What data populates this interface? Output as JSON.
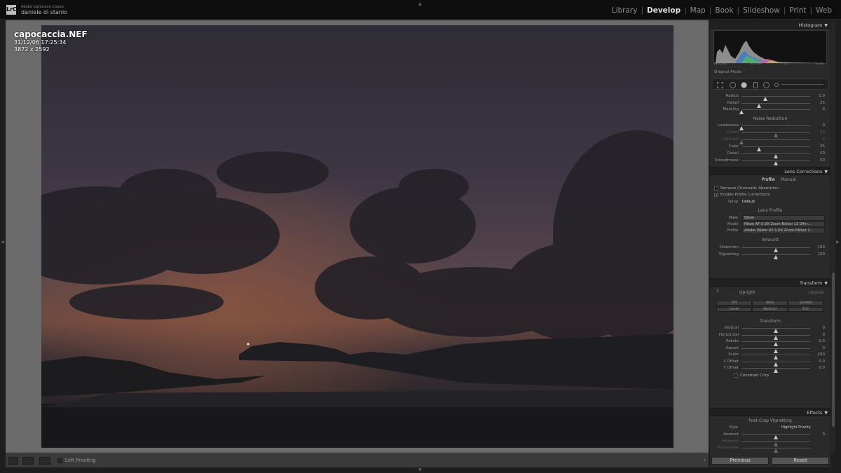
{
  "app": {
    "name": "Adobe Lightroom Classic",
    "user": "daniele di stanio",
    "logo": "LrC"
  },
  "modules": [
    "Library",
    "Develop",
    "Map",
    "Book",
    "Slideshow",
    "Print",
    "Web"
  ],
  "active_module": "Develop",
  "photo": {
    "filename": "capocaccia.NEF",
    "datetime": "31/12/06 17:25:34",
    "dimensions": "3872 x 2592"
  },
  "toolbar": {
    "soft_proofing": "Soft Proofing"
  },
  "histogram": {
    "title": "Histogram",
    "iso": "ISO 100",
    "focal": "24 mm",
    "aperture": "f / 11",
    "shutter": "½ sec",
    "original_photo": "Original Photo"
  },
  "detail": {
    "sharpen": [
      {
        "label": "Radius",
        "value": "1.0",
        "pos": 0.35
      },
      {
        "label": "Detail",
        "value": "25",
        "pos": 0.25
      },
      {
        "label": "Masking",
        "value": "0",
        "pos": 0.0
      }
    ],
    "noise_title": "Noise Reduction",
    "noise": [
      {
        "label": "Luminance",
        "value": "0",
        "pos": 0.0,
        "dim": false
      },
      {
        "label": "Detail",
        "value": "50",
        "pos": 0.5,
        "dim": true
      },
      {
        "label": "Contrast",
        "value": "0",
        "pos": 0.0,
        "dim": true
      },
      {
        "label": "Color",
        "value": "25",
        "pos": 0.25,
        "dim": false
      },
      {
        "label": "Detail",
        "value": "50",
        "pos": 0.5,
        "dim": false
      },
      {
        "label": "Smoothness",
        "value": "50",
        "pos": 0.5,
        "dim": false
      }
    ]
  },
  "lens": {
    "title": "Lens Corrections",
    "tab_profile": "Profile",
    "tab_manual": "Manual",
    "remove_ca": "Remove Chromatic Aberration",
    "enable_profile": "Enable Profile Corrections",
    "setup_label": "Setup",
    "setup_value": "Default",
    "lens_profile": "Lens Profile",
    "make_label": "Make",
    "make_value": "Nikon",
    "model_label": "Model",
    "model_value": "Nikon AF-S DX Zoom-Nikkor 12-24m...",
    "profile_label": "Profile",
    "profile_value": "Adobe (Nikon AF-S DX Zoom-Nikkor 1...",
    "amount": "Amount",
    "amounts": [
      {
        "label": "Distortion",
        "value": "100",
        "pos": 0.5,
        "dim": false
      },
      {
        "label": "Vignetting",
        "value": "100",
        "pos": 0.5,
        "dim": false
      }
    ]
  },
  "transform": {
    "title": "Transform",
    "upright": "Upright",
    "update": "Update",
    "buttons": [
      "Off",
      "Auto",
      "Guided",
      "Level",
      "Vertical",
      "Full"
    ],
    "sub": "Transform",
    "sliders": [
      {
        "label": "Vertical",
        "value": "0",
        "pos": 0.5
      },
      {
        "label": "Horizontal",
        "value": "0",
        "pos": 0.5
      },
      {
        "label": "Rotate",
        "value": "0.0",
        "pos": 0.5
      },
      {
        "label": "Aspect",
        "value": "0",
        "pos": 0.5
      },
      {
        "label": "Scale",
        "value": "100",
        "pos": 0.5
      },
      {
        "label": "X Offset",
        "value": "0.0",
        "pos": 0.5
      },
      {
        "label": "Y Offset",
        "value": "0.0",
        "pos": 0.5
      }
    ],
    "constrain": "Constrain Crop"
  },
  "effects": {
    "title": "Effects",
    "sub": "Post-Crop Vignetting",
    "style_label": "Style",
    "style_value": "Highlight Priority",
    "sliders": [
      {
        "label": "Amount",
        "value": "0",
        "pos": 0.5,
        "dim": false
      },
      {
        "label": "Midpoint",
        "value": "",
        "pos": 0.5,
        "dim": true
      },
      {
        "label": "Roundness",
        "value": "",
        "pos": 0.5,
        "dim": true
      }
    ]
  },
  "buttons": {
    "previous": "Previous",
    "reset": "Reset"
  }
}
